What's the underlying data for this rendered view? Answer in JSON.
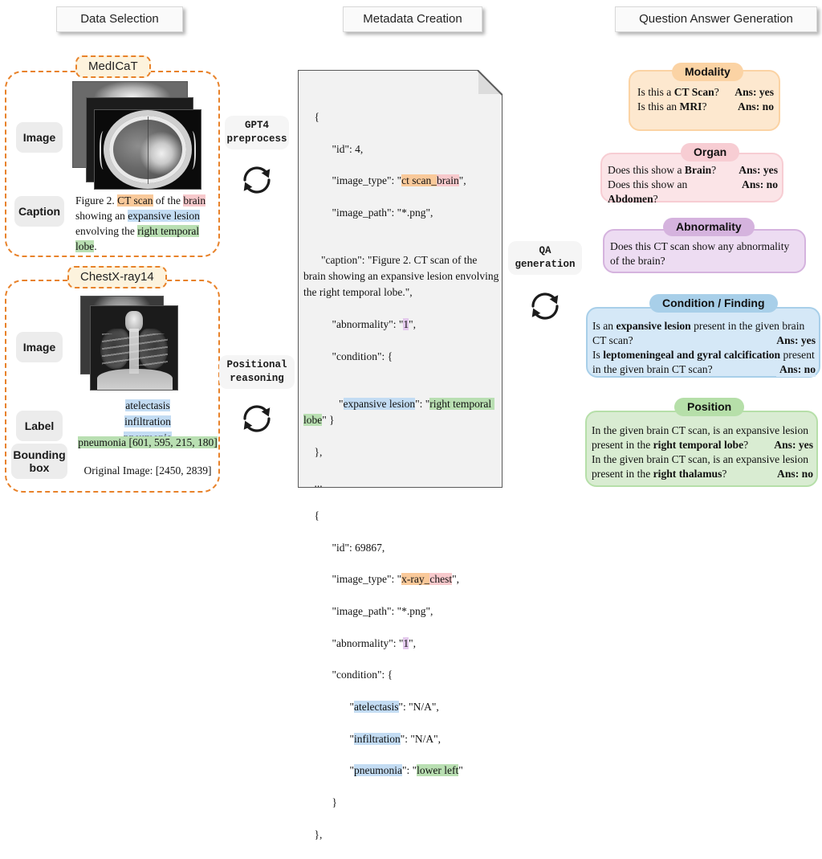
{
  "stages": [
    {
      "label": "Data Selection"
    },
    {
      "label": "Metadata Creation"
    },
    {
      "label": "Question Answer Generation"
    }
  ],
  "datasets": [
    {
      "name": "MedICaT",
      "roles": [
        {
          "label": "Image"
        },
        {
          "label": "Caption"
        }
      ],
      "caption": {
        "prefix": "Figure 2. ",
        "modality": "CT scan",
        "mid1": " of the ",
        "organ": "brain",
        "mid2": " showing an ",
        "condition": "expansive lesion",
        "mid3": " envolving the ",
        "position": "right temporal lobe",
        "suffix": "."
      }
    },
    {
      "name": "ChestX-ray14",
      "roles": [
        {
          "label": "Image"
        },
        {
          "label": "Label"
        },
        {
          "label": "Bounding box"
        }
      ],
      "labels": [
        "atelectasis",
        "infiltration",
        "pneumonia"
      ],
      "bbox_text": "pneumonia [601, 595, 215, 180]",
      "original_image_text": "Original Image: [2450, 2839]"
    }
  ],
  "processes": [
    {
      "label": "GPT4\npreprocess",
      "icon": "cycle-icon"
    },
    {
      "label": "Positional\nreasoning",
      "icon": "cycle-icon"
    },
    {
      "label": "QA\ngeneration",
      "icon": "cycle-icon"
    }
  ],
  "metadata_document": {
    "record1": {
      "open_brace": "{",
      "id_line": "\"id\": 4,",
      "image_type_key": "\"image_type\": \"",
      "image_type_modality": "ct scan",
      "image_type_sep": "_",
      "image_type_organ": "brain",
      "image_type_end": "\",",
      "image_path_line": "\"image_path\": \"*.png\",",
      "caption_line": "\"caption\": \"Figure 2. CT scan of the brain showing an expansive lesion envolving the right temporal lobe.\",",
      "abnormality_key": "\"abnormality\": \"",
      "abnormality_value": "1",
      "abnormality_end": "\",",
      "condition_key": "\"condition\": {",
      "condition_name": "expansive lesion",
      "condition_position": "right temporal lobe",
      "close_brace": "},"
    },
    "ellipsis": "...",
    "record2": {
      "open_brace": "{",
      "id_line": "\"id\": 69867,",
      "image_type_key": "\"image_type\": \"",
      "image_type_modality": "x-ray",
      "image_type_sep": "_",
      "image_type_organ": "chest",
      "image_type_end": "\",",
      "image_path_line": "\"image_path\": \"*.png\",",
      "abnormality_key": "\"abnormality\": \"",
      "abnormality_value": "1",
      "abnormality_end": "\",",
      "condition_key": "\"condition\": {",
      "findings": [
        {
          "name": "atelectasis",
          "value": "N/A",
          "value_highlight": false
        },
        {
          "name": "infiltration",
          "value": "N/A",
          "value_highlight": false
        },
        {
          "name": "pneumonia",
          "value": "lower left",
          "value_highlight": true
        }
      ],
      "inner_close": "}",
      "close_brace": "},"
    }
  },
  "qa_cards": [
    {
      "title": "Modality",
      "tab_color": "#fbd3a4",
      "body_color": "#fde8cf",
      "border_color": "#fbd3a4",
      "rows": [
        {
          "question_plain": "Is this a ",
          "question_bold": "CT Scan",
          "question_tail": "?",
          "answer": "Ans: yes"
        },
        {
          "question_plain": "Is this an ",
          "question_bold": "MRI",
          "question_tail": "?",
          "answer": "Ans: no"
        }
      ]
    },
    {
      "title": "Organ",
      "tab_color": "#f7cdd3",
      "body_color": "#fbe4e7",
      "border_color": "#f7cdd3",
      "rows": [
        {
          "question_plain": "Does this show a ",
          "question_bold": "Brain",
          "question_tail": "?",
          "answer": "Ans: yes"
        },
        {
          "question_plain": "Does this show an ",
          "question_bold": "Abdomen",
          "question_tail": "?",
          "answer": "Ans: no"
        }
      ]
    },
    {
      "title": "Abnormality",
      "tab_color": "#d5b3de",
      "body_color": "#eddcf2",
      "border_color": "#d5b3de",
      "rows": [
        {
          "question_plain": "Does this CT scan show any abnormality of the brain?",
          "question_bold": "",
          "question_tail": "",
          "answer": ""
        }
      ]
    },
    {
      "title": "Condition / Finding",
      "tab_color": "#a8cfe9",
      "body_color": "#d5e8f7",
      "border_color": "#a8cfe9",
      "rows": [
        {
          "question_plain": "Is an ",
          "question_bold": "expansive lesion",
          "question_tail": " present in the given brain CT scan?",
          "answer": "Ans: yes"
        },
        {
          "question_plain": "Is ",
          "question_bold": "leptomeningeal and gyral calcification",
          "question_tail": " present in the given brain CT scan?",
          "answer": "Ans: no"
        }
      ]
    },
    {
      "title": "Position",
      "tab_color": "#b6dfa9",
      "body_color": "#d9ecd2",
      "border_color": "#b6dfa9",
      "rows": [
        {
          "question_plain": "In the given brain CT scan, is an expansive lesion present in the ",
          "question_bold": "right temporal lobe",
          "question_tail": "?",
          "answer": "Ans: yes"
        },
        {
          "question_plain": "In the given brain CT scan, is an expansive lesion present in the ",
          "question_bold": "right thalamus",
          "question_tail": "?",
          "answer": "Ans: no"
        }
      ]
    }
  ],
  "colors": {
    "dashed_border": "#e8822a",
    "dataset_tag_bg": "#fdf3dd",
    "highlight_modality": "#f9c99a",
    "highlight_organ": "#f7c9cc",
    "highlight_condition": "#c3dcf3",
    "highlight_position": "#b9dfb2",
    "highlight_abnormality": "#e3c9ec"
  }
}
